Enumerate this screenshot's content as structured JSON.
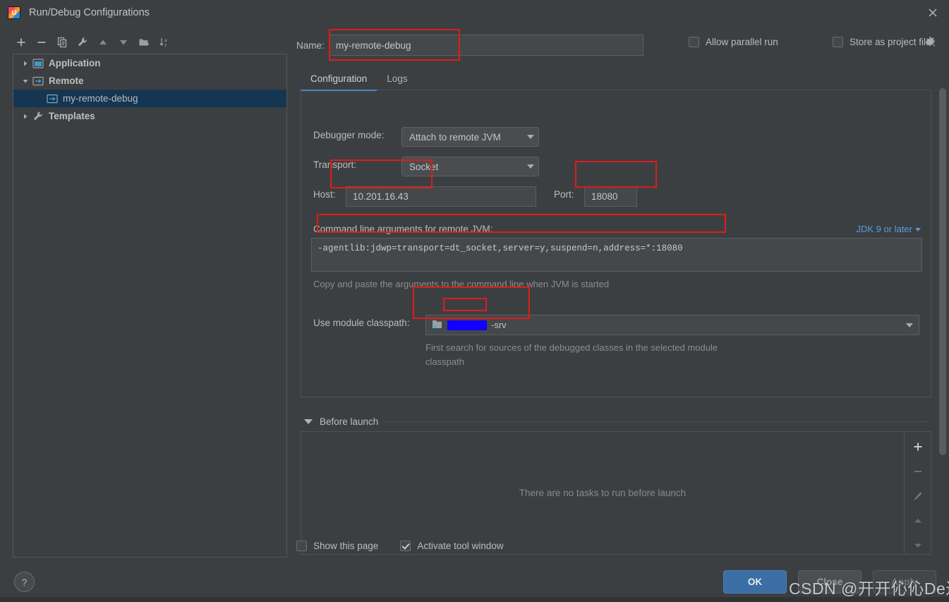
{
  "window": {
    "title": "Run/Debug Configurations",
    "app_icon": "intellij-idea-icon",
    "close_icon": "close-icon"
  },
  "sidebar": {
    "toolbar": [
      {
        "name": "add-configuration-button",
        "icon": "plus-icon",
        "label": "+"
      },
      {
        "name": "remove-configuration-button",
        "icon": "minus-icon",
        "label": "−"
      },
      {
        "name": "copy-configuration-button",
        "icon": "copy-icon",
        "label": "copy"
      },
      {
        "name": "edit-templates-button",
        "icon": "wrench-icon",
        "label": "wrench"
      },
      {
        "name": "move-up-button",
        "icon": "arrow-up-icon",
        "label": "up"
      },
      {
        "name": "move-down-button",
        "icon": "arrow-down-icon",
        "label": "down"
      },
      {
        "name": "new-folder-button",
        "icon": "folder-add-icon",
        "label": "folder"
      },
      {
        "name": "sort-alphabetically-button",
        "icon": "sort-az-icon",
        "label": "sort"
      }
    ],
    "tree": [
      {
        "label": "Application",
        "icon": "application-icon",
        "expanded": false,
        "level": 0,
        "selected": false
      },
      {
        "label": "Remote",
        "icon": "remote-icon",
        "expanded": true,
        "level": 0,
        "selected": false
      },
      {
        "label": "my-remote-debug",
        "icon": "remote-icon",
        "expanded": null,
        "level": 1,
        "selected": true
      },
      {
        "label": "Templates",
        "icon": "wrench-icon",
        "expanded": false,
        "level": 0,
        "selected": false
      }
    ]
  },
  "form": {
    "name_label": "Name:",
    "name_value": "my-remote-debug",
    "allow_parallel_run": {
      "label": "Allow parallel run",
      "checked": false
    },
    "store_as_project_file": {
      "label": "Store as project file",
      "checked": false
    },
    "gear_icon": "gear-icon"
  },
  "tabs": [
    {
      "label": "Configuration",
      "active": true
    },
    {
      "label": "Logs",
      "active": false
    }
  ],
  "configuration": {
    "debugger_mode_label": "Debugger mode:",
    "debugger_mode_value": "Attach to remote JVM",
    "transport_label": "Transport:",
    "transport_value": "Socket",
    "host_label": "Host:",
    "host_value": "10.201.16.43",
    "port_label": "Port:",
    "port_value": "18080",
    "cmdline_label": "Command line arguments for remote JVM:",
    "jdk_selector": "JDK 9 or later",
    "cmdline_value": "-agentlib:jdwp=transport=dt_socket,server=y,suspend=n,address=*:18080",
    "cmdline_hint": "Copy and paste the arguments to the command line when JVM is started",
    "module_classpath_label": "Use module classpath:",
    "module_classpath_value": "-srv",
    "module_classpath_redacted": true,
    "module_classpath_hint": "First search for sources of the debugged classes in the selected module classpath"
  },
  "before_launch": {
    "title": "Before launch",
    "expanded": true,
    "empty_message": "There are no tasks to run before launch",
    "tools": [
      {
        "name": "add-task-button",
        "icon": "plus-icon"
      },
      {
        "name": "remove-task-button",
        "icon": "minus-icon"
      },
      {
        "name": "edit-task-button",
        "icon": "pencil-icon"
      },
      {
        "name": "move-task-up-button",
        "icon": "arrow-up-icon"
      },
      {
        "name": "move-task-down-button",
        "icon": "arrow-down-icon"
      }
    ]
  },
  "options": {
    "show_this_page": {
      "label": "Show this page",
      "checked": false
    },
    "activate_tool_window": {
      "label": "Activate tool window",
      "checked": true
    }
  },
  "buttons": {
    "ok": "OK",
    "close": "Close",
    "apply": "Apply",
    "help": "?"
  },
  "watermark": "CSDN @开开伈伈De过",
  "colors": {
    "background": "#3c3f41",
    "accent_blue": "#4a88c7",
    "selection_blue": "#143652",
    "link_blue": "#5b9ae0",
    "ok_button": "#3a6ea5",
    "annotation_red": "#e01b1b",
    "redaction_blue": "#1000ff"
  }
}
